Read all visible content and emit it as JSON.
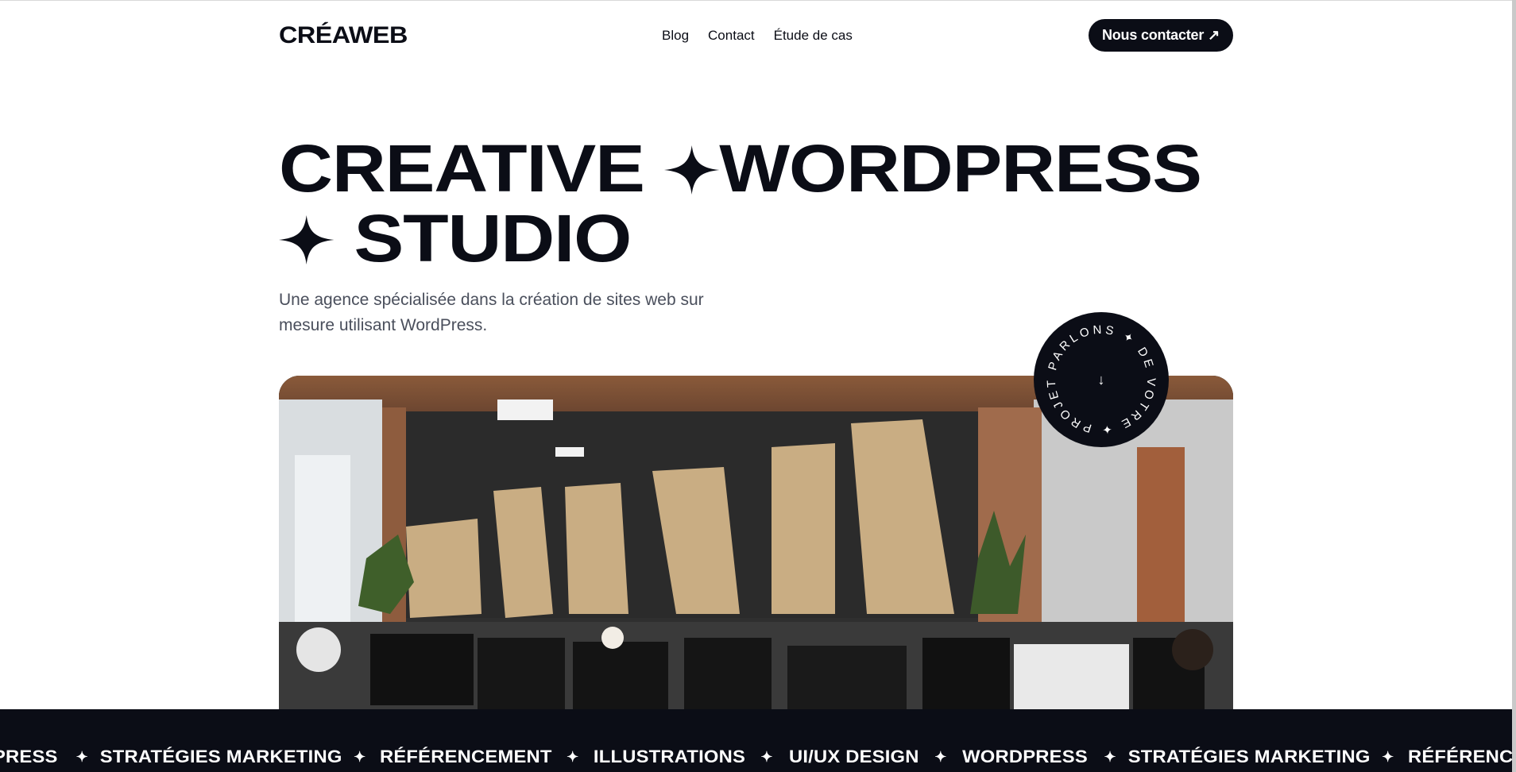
{
  "brand": {
    "logo": "CRÉAWEB"
  },
  "nav": {
    "items": [
      "Blog",
      "Contact",
      "Étude de cas"
    ]
  },
  "cta": {
    "label": "Nous contacter",
    "icon": "arrow-up-right-icon",
    "arrow": "↗"
  },
  "hero": {
    "line1_a": "CREATIVE",
    "line1_b": "WORDPRESS",
    "line2": "STUDIO",
    "spark_icon": "sparkle-icon",
    "subtitle": "Une agence spécialisée dans la création de sites web sur mesure utilisant WordPress."
  },
  "badge": {
    "circular_text": "PARLONS ✦ DE VOTRE ✦ PROJET ✦",
    "arrow": "↓",
    "icon": "arrow-down-icon"
  },
  "photo": {
    "description_icon": "office-photo"
  },
  "ticker": {
    "items": [
      "PRESS",
      "STRATÉGIES MARKETING",
      "RÉFÉRENCEMENT",
      "ILLUSTRATIONS",
      "UI/UX DESIGN",
      "WORDPRESS",
      "STRATÉGIES MARKETING",
      "RÉFÉRENCEMENT"
    ],
    "separator": "✦"
  },
  "colors": {
    "ink": "#0b0d16",
    "text_muted": "#4a4f5c",
    "background": "#ffffff"
  }
}
